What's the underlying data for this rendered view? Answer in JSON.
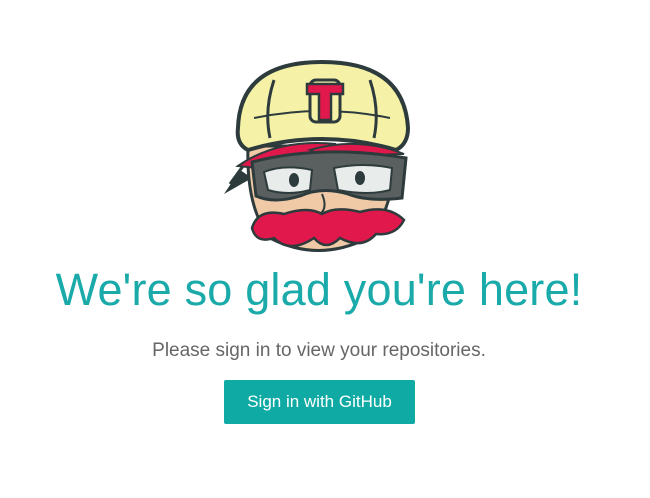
{
  "mascot": {
    "icon": "travis-mascot-icon",
    "helmet_letter": "T",
    "colors": {
      "helmet": "#f5f2a7",
      "outline": "#2e3b3c",
      "brand_red": "#e0184c",
      "goggles": "#59605f",
      "skin": "#f0c9a6"
    }
  },
  "headline": "We're so glad you're here!",
  "subtitle": "Please sign in to view your repositories.",
  "signin_button": {
    "label": "Sign in with GitHub"
  },
  "colors": {
    "headline": "#19aaa9",
    "subtitle": "#666666",
    "button_bg": "#10aaa4",
    "button_text": "#ffffff"
  }
}
